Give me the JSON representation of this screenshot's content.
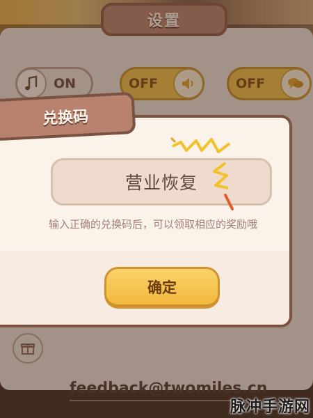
{
  "settings": {
    "title": "设置",
    "toggles": [
      {
        "id": "music",
        "state_label": "ON"
      },
      {
        "id": "sound",
        "state_label": "OFF"
      },
      {
        "id": "chat",
        "state_label": "OFF"
      }
    ],
    "feedback_email": "feedback@twomiles.cn"
  },
  "redeem": {
    "title": "兑换码",
    "input_value": "营业恢复",
    "hint": "输入正确的兑换码后，可以领取相应的奖励哦",
    "confirm_label": "确定"
  },
  "watermark": "脉冲手游网",
  "icons": {
    "music": "music-note-icon",
    "sound": "speaker-icon",
    "chat": "chat-bubble-icon",
    "gift": "gift-icon"
  },
  "colors": {
    "accent_yellow": "#f3b73e",
    "panel_brown": "#b9826f",
    "border_brown": "#7a5242"
  }
}
